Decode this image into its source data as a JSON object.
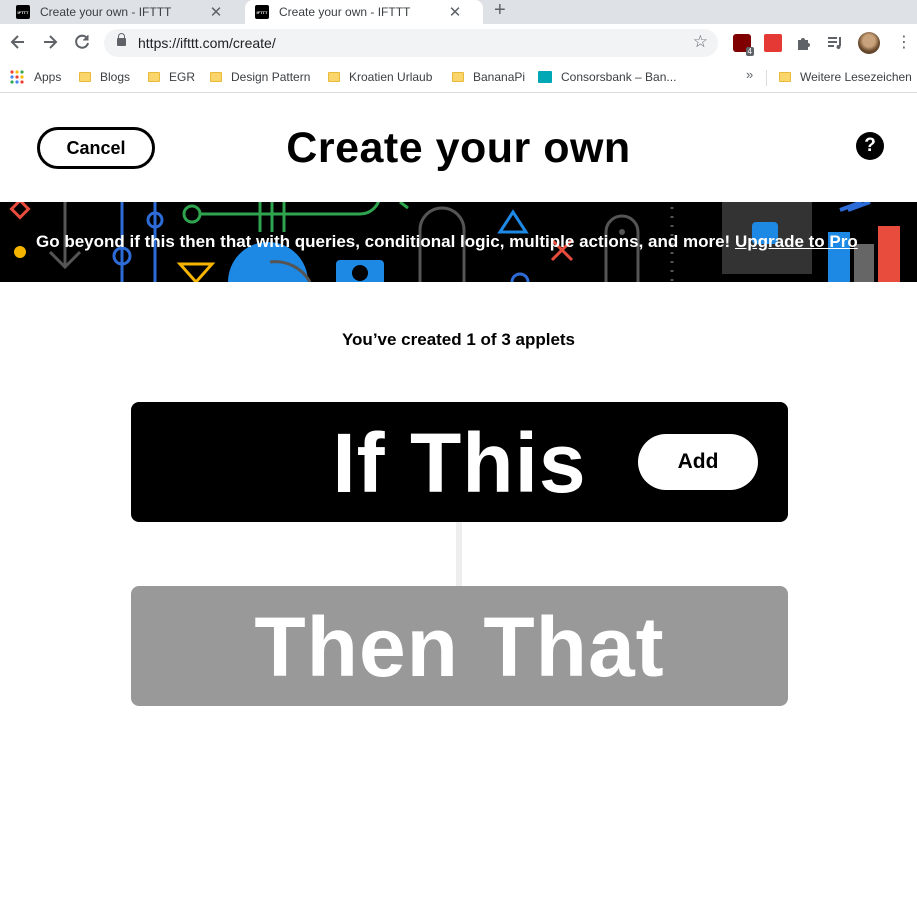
{
  "browser": {
    "tabs": [
      {
        "title": "Create your own - IFTTT",
        "active": false
      },
      {
        "title": "Create your own - IFTTT",
        "active": true
      }
    ],
    "new_tab_symbol": "+",
    "close_symbol": "✕",
    "url": "https://ifttt.com/create/",
    "extension_badge": "4",
    "bookmarks": [
      {
        "label": "Apps",
        "icon": "apps-grid-icon"
      },
      {
        "label": "Blogs",
        "icon": "folder-icon"
      },
      {
        "label": "EGR",
        "icon": "folder-icon"
      },
      {
        "label": "Design Pattern",
        "icon": "folder-icon"
      },
      {
        "label": "Kroatien Urlaub",
        "icon": "folder-icon"
      },
      {
        "label": "BananaPi",
        "icon": "folder-icon"
      },
      {
        "label": "Consorsbank – Ban...",
        "icon": "consorsbank-icon"
      }
    ],
    "more_bookmarks_symbol": "»",
    "other_bookmarks": "Weitere Lesezeichen"
  },
  "page": {
    "cancel_label": "Cancel",
    "title": "Create your own",
    "help_symbol": "?",
    "banner": {
      "text": "Go beyond if this then that with queries, conditional logic, multiple actions, and more!",
      "link": "Upgrade to Pro"
    },
    "applet_count": "You’ve created 1 of 3 applets",
    "trigger_label": "If This",
    "add_label": "Add",
    "action_label": "Then That"
  },
  "colors": {
    "background": "#ffffff",
    "primary": "#000000",
    "disabled_block": "#999999",
    "connector": "#eeeeee",
    "tab_strip": "#dee1e6"
  }
}
